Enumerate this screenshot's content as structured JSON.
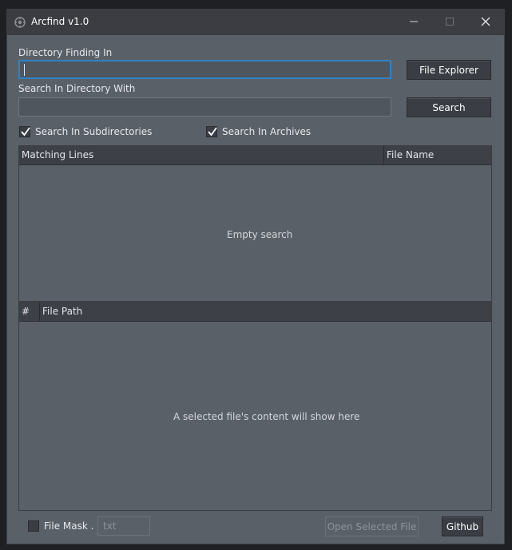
{
  "window": {
    "title": "Arcfind v1.0",
    "controls": {
      "minimize_icon": "minimize-icon",
      "maximize_icon": "maximize-icon",
      "close_icon": "close-icon"
    }
  },
  "form": {
    "directory_label": "Directory Finding In",
    "directory_value": "",
    "file_explorer_label": "File Explorer",
    "search_label": "Search In Directory With",
    "search_value": "",
    "search_button_label": "Search"
  },
  "options": {
    "subdirectories": {
      "label": "Search In Subdirectories",
      "checked": true
    },
    "archives": {
      "label": "Search In Archives",
      "checked": true
    }
  },
  "results_table": {
    "columns": [
      "Matching Lines",
      "File Name"
    ],
    "empty_text": "Empty search"
  },
  "content_table": {
    "columns": [
      "#",
      "File Path"
    ],
    "empty_text": "A selected file's content will show here"
  },
  "footer": {
    "file_mask_label": "File Mask .",
    "file_mask_checked": false,
    "file_mask_placeholder": "txt",
    "open_selected_label": "Open Selected File",
    "github_label": "Github"
  },
  "colors": {
    "window_bg": "#5a6068",
    "titlebar_bg": "#3b3d42",
    "focus_border": "#2f82c4",
    "button_bg": "#3a3e44"
  }
}
